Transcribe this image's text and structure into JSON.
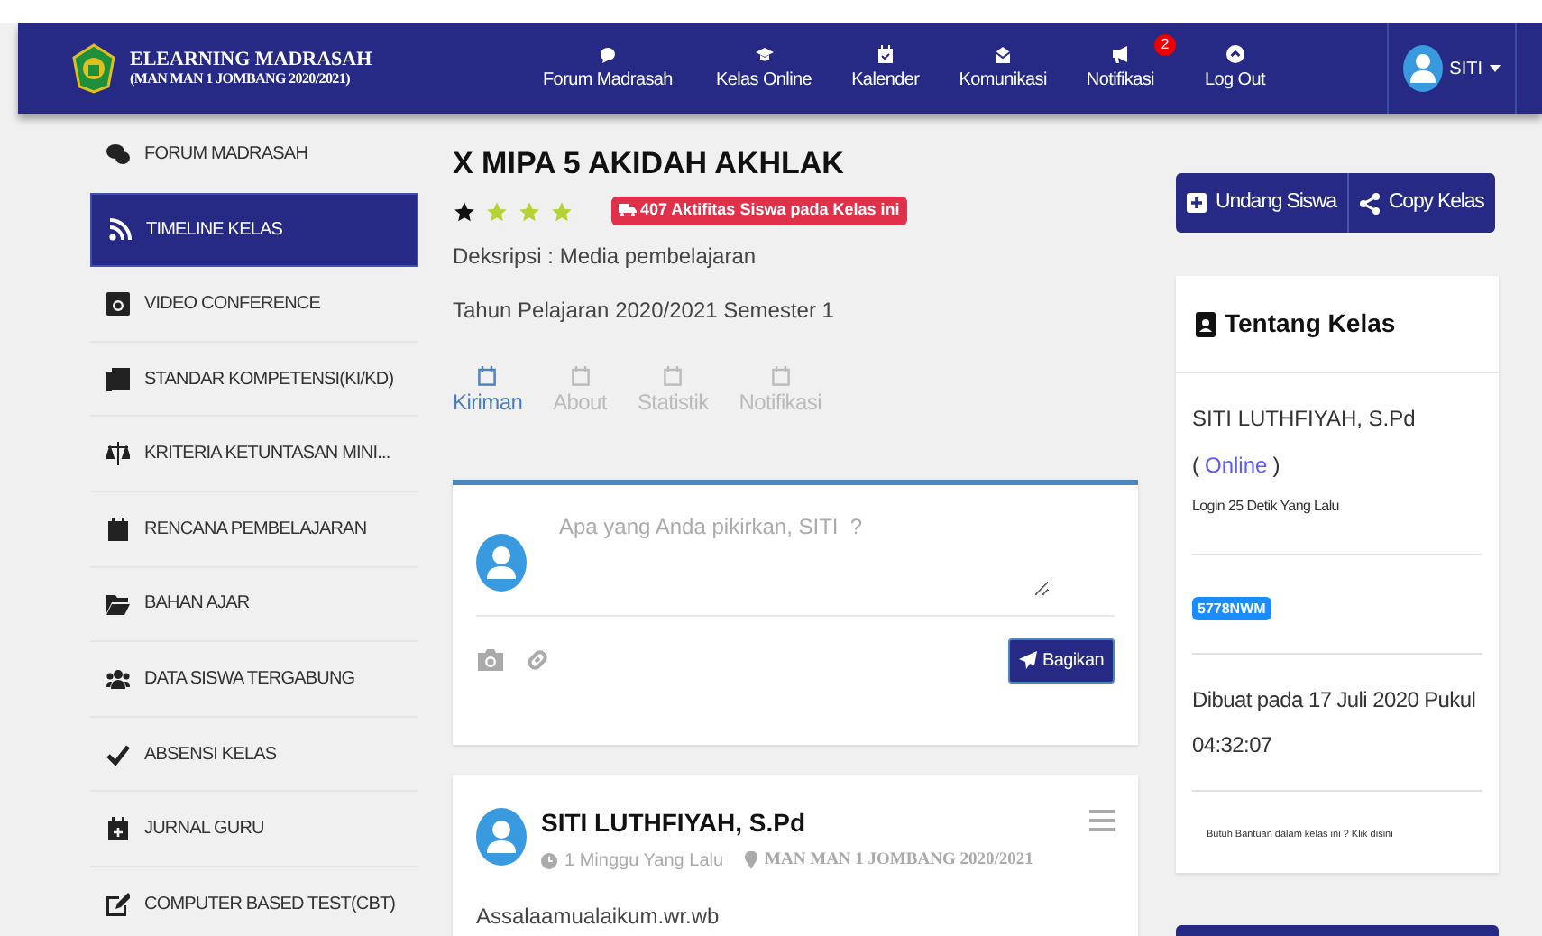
{
  "brand": {
    "title": "ELEARNING MADRASAH",
    "subtitle": "(MAN MAN 1 JOMBANG 2020/2021)"
  },
  "nav": [
    {
      "label": "Forum Madrasah",
      "kind": "chat"
    },
    {
      "label": "Kelas Online",
      "kind": "cap"
    },
    {
      "label": "Kalender",
      "kind": "calendar"
    },
    {
      "label": "Komunikasi",
      "kind": "mail"
    },
    {
      "label": "Notifikasi",
      "kind": "bullhorn",
      "badge": "2"
    },
    {
      "label": "Log Out",
      "kind": "logout"
    }
  ],
  "user": {
    "label": "SITI"
  },
  "sidebar": {
    "items": [
      {
        "label": "FORUM MADRASAH",
        "kind": "chat",
        "selected": false
      },
      {
        "label": "TIMELINE KELAS",
        "kind": "rss",
        "selected": true
      },
      {
        "label": "VIDEO CONFERENCE",
        "kind": "camera",
        "selected": false
      },
      {
        "label": "STANDAR KOMPETENSI(KI/KD)",
        "kind": "book",
        "selected": false
      },
      {
        "label": "KRITERIA KETUNTASAN MINI...",
        "kind": "scale",
        "selected": false
      },
      {
        "label": "RENCANA PEMBELAJARAN",
        "kind": "calendar",
        "selected": false
      },
      {
        "label": "BAHAN AJAR",
        "kind": "folder",
        "selected": false
      },
      {
        "label": "DATA SISWA TERGABUNG",
        "kind": "users",
        "selected": false
      },
      {
        "label": "ABSENSI KELAS",
        "kind": "check",
        "selected": false
      },
      {
        "label": "JURNAL GURU",
        "kind": "journal",
        "selected": false
      },
      {
        "label": "COMPUTER BASED TEST(CBT)",
        "kind": "edit",
        "selected": false
      }
    ]
  },
  "class": {
    "title": "X MIPA 5 AKIDAH AKHLAK",
    "stars": 3,
    "activity_badge": "407 Aktifitas Siswa pada Kelas ini",
    "description": "Deksripsi : Media pembelajaran",
    "year": "Tahun Pelajaran 2020/2021 Semester 1"
  },
  "tabs": [
    {
      "label": "Kiriman",
      "selected": true
    },
    {
      "label": "About",
      "selected": false
    },
    {
      "label": "Statistik",
      "selected": false
    },
    {
      "label": "Notifikasi",
      "selected": false
    }
  ],
  "composer": {
    "placeholder": "Apa yang Anda pikirkan, SITI  ?",
    "button": "Bagikan"
  },
  "post": {
    "author": "SITI LUTHFIYAH, S.Pd",
    "time": "1 Minggu Yang Lalu",
    "place": "MAN MAN 1 JOMBANG 2020/2021",
    "text": "Assalaamualaikum.wr.wb"
  },
  "actions": [
    {
      "label": "Undang Siswa",
      "kind": "plus"
    },
    {
      "label": "Copy Kelas",
      "kind": "share"
    }
  ],
  "about": {
    "title": "Tentang Kelas",
    "teacher": "SITI LUTHFIYAH, S.Pd",
    "status_open": "(",
    "status": "Online",
    "status_close": ")",
    "login": "Login 25 Detik Yang Lalu",
    "code": "5778NWM",
    "created": "Dibuat pada 17 Juli 2020 Pukul 04:32:07",
    "help": "Butuh Bantuan dalam kelas ini ? Klik disini"
  }
}
